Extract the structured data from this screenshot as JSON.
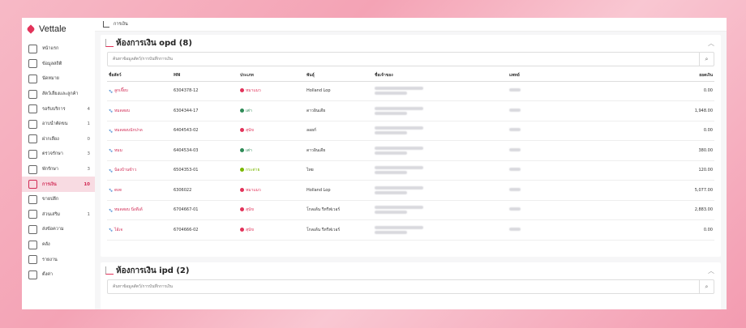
{
  "app": {
    "name": "Vettale"
  },
  "breadcrumb": {
    "label": "การเงิน"
  },
  "sidebar": {
    "items": [
      {
        "label": "หน้าแรก",
        "count": ""
      },
      {
        "label": "ข้อมูลสถิติ",
        "count": ""
      },
      {
        "label": "นัดหมาย",
        "count": ""
      },
      {
        "label": "สัตว์เลี้ยงและลูกค้า",
        "count": ""
      },
      {
        "label": "รอรับบริการ",
        "count": "4"
      },
      {
        "label": "อาบน้ำตัดขน",
        "count": "1"
      },
      {
        "label": "ฝากเลี้ยง",
        "count": "0"
      },
      {
        "label": "ตรวจรักษา",
        "count": "3"
      },
      {
        "label": "พักรักษา",
        "count": "3"
      },
      {
        "label": "การเงิน",
        "count": "10"
      },
      {
        "label": "ขายปลีก",
        "count": ""
      },
      {
        "label": "ส่วนเสริม",
        "count": "1"
      },
      {
        "label": "ส่งข้อความ",
        "count": ""
      },
      {
        "label": "คลัง",
        "count": ""
      },
      {
        "label": "รายงาน",
        "count": ""
      },
      {
        "label": "ตั้งค่า",
        "count": ""
      }
    ]
  },
  "opd": {
    "title": "ห้องการเงิน opd (8)",
    "search_placeholder": "ค้นหาข้อมูลสัตว์/การบันทึกการเงิน",
    "columns": [
      "ชื่อสัตว์",
      "HN",
      "ประเภท",
      "พันธุ์",
      "ชื่อเจ้าของ",
      "แพทย์",
      "ยอดเงิน"
    ],
    "rows": [
      {
        "name": "ลูกเจี๊ยบ",
        "hn": "6304378-12",
        "type": "หมาแมว",
        "type_color": "#e2335a",
        "breed": "Holland Lop",
        "amount": "0.00"
      },
      {
        "name": "หมดสอบ",
        "hn": "6304344-17",
        "type": "เต่า",
        "type_color": "#2e8b57",
        "breed": "ดาวอินเดีย",
        "amount": "1,948.00"
      },
      {
        "name": "หมดสอบนักปาด",
        "hn": "6404543-02",
        "type": "สุนัข",
        "type_color": "#e2335a",
        "breed": "ลอยก์",
        "amount": "0.00"
      },
      {
        "name": "หมม",
        "hn": "6404534-03",
        "type": "เต่า",
        "type_color": "#2e8b57",
        "breed": "ดาวอินเดีย",
        "amount": "380.00"
      },
      {
        "name": "น้องบ้านข้าว",
        "hn": "6504353-01",
        "type": "กระต่าย",
        "type_color": "#7ab800",
        "breed": "ไทย",
        "amount": "120.00"
      },
      {
        "name": "eve",
        "hn": "6306022",
        "type": "หมาแมว",
        "type_color": "#e2335a",
        "breed": "Holland Lop",
        "amount": "5,077.00"
      },
      {
        "name": "หมดสอบ นิ่งดีเด้",
        "hn": "6704667-01",
        "type": "สุนัข",
        "type_color": "#e2335a",
        "breed": "โกลเด้น รีทรีฟเวอร์",
        "amount": "2,883.00"
      },
      {
        "name": "ไอ้เจ",
        "hn": "6704666-02",
        "type": "สุนัข",
        "type_color": "#e2335a",
        "breed": "โกลเด้น รีทรีฟเวอร์",
        "amount": "0.00"
      }
    ]
  },
  "ipd": {
    "title": "ห้องการเงิน ipd (2)",
    "search_placeholder": "ค้นหาข้อมูลสัตว์/การบันทึกการเงิน"
  },
  "colors": {
    "accent": "#d12b55",
    "active_bg": "#f8dbe2"
  }
}
